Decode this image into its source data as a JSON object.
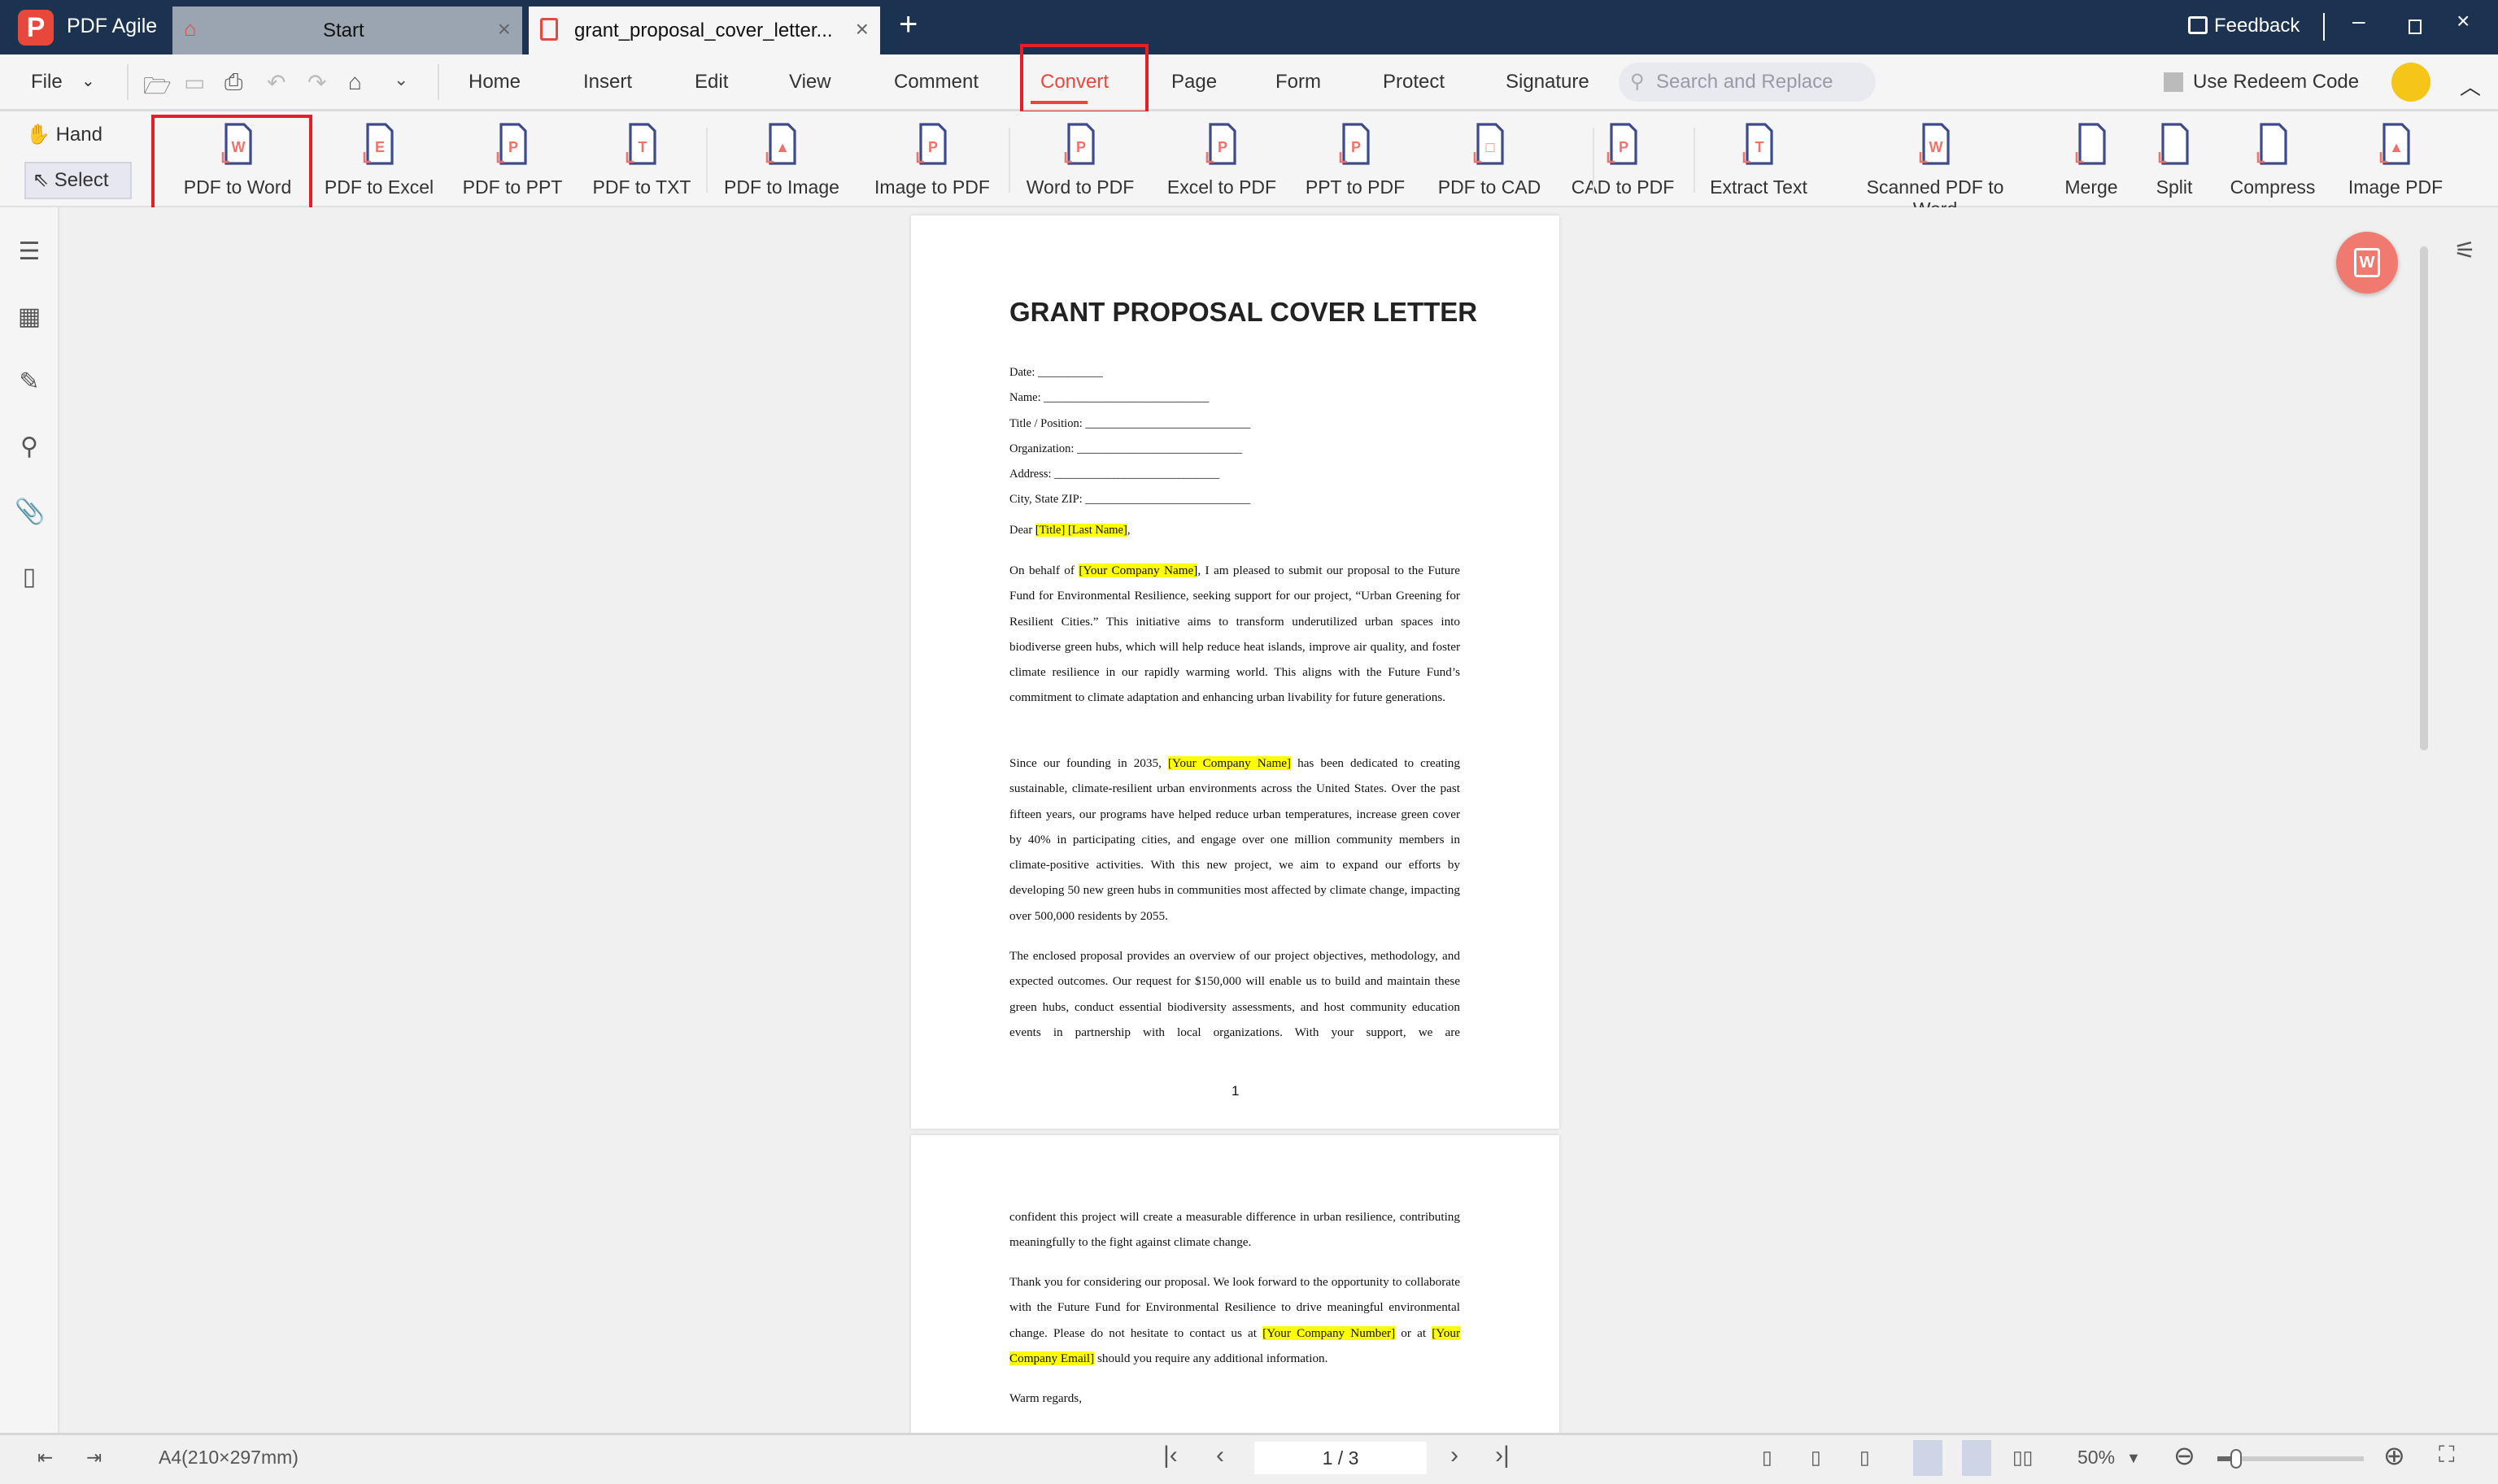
{
  "app": {
    "title": "PDF Agile",
    "feedback": "Feedback"
  },
  "tabs": [
    {
      "label": "Start"
    },
    {
      "label": "grant_proposal_cover_letter..."
    }
  ],
  "menu": {
    "file": "File",
    "tabs": [
      "Home",
      "Insert",
      "Edit",
      "View",
      "Comment",
      "Convert",
      "Page",
      "Form",
      "Protect",
      "Signature"
    ],
    "active": "Convert",
    "search_placeholder": "Search and Replace",
    "redeem": "Use Redeem Code"
  },
  "tools": {
    "hand": "Hand",
    "select": "Select"
  },
  "ribbon": [
    {
      "label": "PDF to Word",
      "glyph": "W"
    },
    {
      "label": "PDF to Excel",
      "glyph": "E"
    },
    {
      "label": "PDF to PPT",
      "glyph": "P"
    },
    {
      "label": "PDF to TXT",
      "glyph": "T"
    },
    {
      "label": "PDF to Image",
      "glyph": "▲"
    },
    {
      "label": "Image to PDF",
      "glyph": "P"
    },
    {
      "label": "Word to PDF",
      "glyph": "P"
    },
    {
      "label": "Excel to PDF",
      "glyph": "P"
    },
    {
      "label": "PPT to PDF",
      "glyph": "P"
    },
    {
      "label": "PDF to CAD",
      "glyph": "□"
    },
    {
      "label": "CAD to PDF",
      "glyph": "P"
    },
    {
      "label": "Extract Text",
      "glyph": "T"
    },
    {
      "label": "Scanned PDF to Word",
      "glyph": "W"
    },
    {
      "label": "Merge",
      "glyph": ""
    },
    {
      "label": "Split",
      "glyph": ""
    },
    {
      "label": "Compress",
      "glyph": ""
    },
    {
      "label": "Image PDF",
      "glyph": "▲"
    }
  ],
  "document": {
    "title": "GRANT PROPOSAL COVER LETTER",
    "fields": [
      "Date: ___________",
      "Name: ____________________________",
      "Title / Position: ____________________________",
      "Organization: ____________________________",
      "Address: ____________________________",
      "City, State ZIP: ____________________________"
    ],
    "salutation": {
      "before": "Dear ",
      "highlight": "[Title] [Last Name]",
      "after": ","
    },
    "p1": {
      "before": "On behalf of ",
      "highlight": "[Your Company Name]",
      "after": ", I am pleased to submit our proposal to the Future Fund for Environmental Resilience, seeking support for our project, “Urban Greening for Resilient Cities.” This initiative aims to transform underutilized urban spaces into biodiverse green hubs, which will help reduce heat islands, improve air quality, and foster climate resilience in our rapidly warming world. This aligns with the Future Fund’s commitment to climate adaptation and enhancing urban livability for future generations."
    },
    "p2": {
      "before": "Since our founding in 2035, ",
      "highlight": "[Your Company Name]",
      "after": " has been dedicated to creating sustainable, climate-resilient urban environments across the United States. Over the past fifteen years, our programs have helped reduce urban temperatures, increase green cover by 40% in participating cities, and engage over one million community members in climate-positive activities. With this new project, we aim to expand our efforts by developing 50 new green hubs in communities most affected by climate change, impacting over 500,000 residents by 2055."
    },
    "p3": "The enclosed proposal provides an overview of our project objectives, methodology, and expected outcomes. Our request for $150,000 will enable us to build and maintain these green hubs, conduct essential biodiversity assessments, and host community education events in partnership with local organizations. With your support, we are",
    "page_number": "1",
    "p3_cont": "confident this project will create a measurable difference in urban resilience, contributing meaningfully to the fight against climate change.",
    "p4": {
      "before": "Thank you for considering our proposal. We look forward to the opportunity to collaborate with the Future Fund for Environmental Resilience to drive meaningful environmental change. Please do not hesitate to contact us at ",
      "highlight1": "[Your Company Number]",
      "middle": " or at ",
      "highlight2": "[Your Company Email]",
      "after": " should you require any additional information."
    },
    "closing": "Warm regards,"
  },
  "status": {
    "page_size": "A4(210×297mm)",
    "page_indicator": "1 / 3",
    "zoom": "50%",
    "zoom_fraction": 0.5
  },
  "colors": {
    "titlebar": "#1b3350",
    "accent": "#e8483b",
    "highlight": "#ffff00"
  }
}
